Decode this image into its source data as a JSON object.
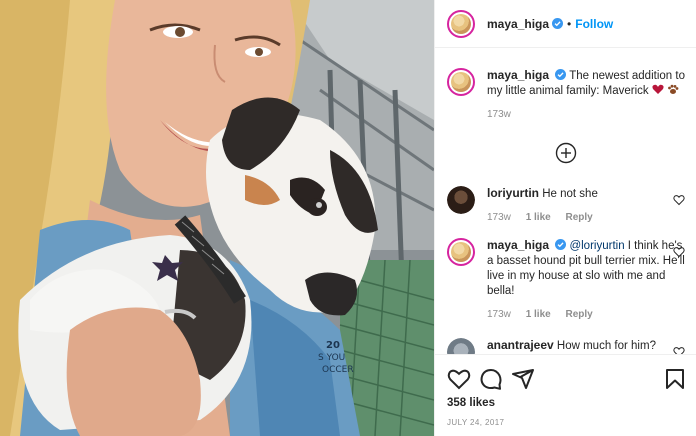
{
  "post": {
    "author": "maya_higa",
    "follow_label": "Follow",
    "dot": "•"
  },
  "caption": {
    "username": "maya_higa",
    "text": "The newest addition to my little animal family: Maverick",
    "time": "173w",
    "emoji": [
      "heart-emoji",
      "paw-emoji"
    ]
  },
  "load_more": {
    "icon": "plus-circle-icon"
  },
  "comments": [
    {
      "username": "loriyurtin",
      "text": "He not she",
      "time": "173w",
      "likes": "1 like",
      "reply": "Reply"
    },
    {
      "username": "maya_higa",
      "mention": "@loriyurtin",
      "text": "I think he's a basset hound pit bull terrier mix. He'll live in my house at slo with me and bella!",
      "time": "173w",
      "likes": "1 like",
      "reply": "Reply"
    },
    {
      "username": "anantrajeev",
      "text": "How much for him?"
    }
  ],
  "actions": {
    "icons": [
      "heart-icon",
      "comment-icon",
      "share-icon",
      "bookmark-icon"
    ],
    "likes": "358 likes",
    "date": "JULY 24, 2017"
  },
  "photo": {
    "shirt_text_1": "20",
    "shirt_text_2": "S YOU",
    "shirt_text_3": "OCCER"
  },
  "colors": {
    "accent": "#0095f6",
    "text": "#262626",
    "muted": "#8e8e8e",
    "verified": "#3897f0"
  }
}
